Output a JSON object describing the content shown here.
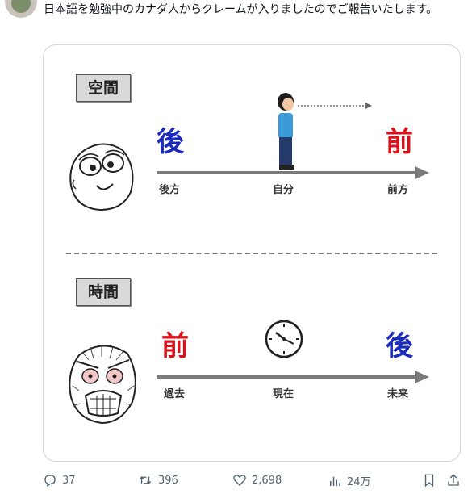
{
  "tweet": {
    "text": "日本語を勉強中のカナダ人からクレームが入りましたのでご報告いたします。"
  },
  "diagram": {
    "space": {
      "tag": "空間",
      "left_big": "後",
      "right_big": "前",
      "left_label": "後方",
      "center_label": "自分",
      "right_label": "前方"
    },
    "time": {
      "tag": "時間",
      "left_big": "前",
      "right_big": "後",
      "left_label": "過去",
      "center_label": "現在",
      "right_label": "未来"
    }
  },
  "actions": {
    "replies": "37",
    "reposts": "396",
    "likes": "2,698",
    "views": "24万"
  },
  "colors": {
    "blue": "#1a2bbf",
    "red": "#d8131b",
    "icon": "#536471"
  }
}
